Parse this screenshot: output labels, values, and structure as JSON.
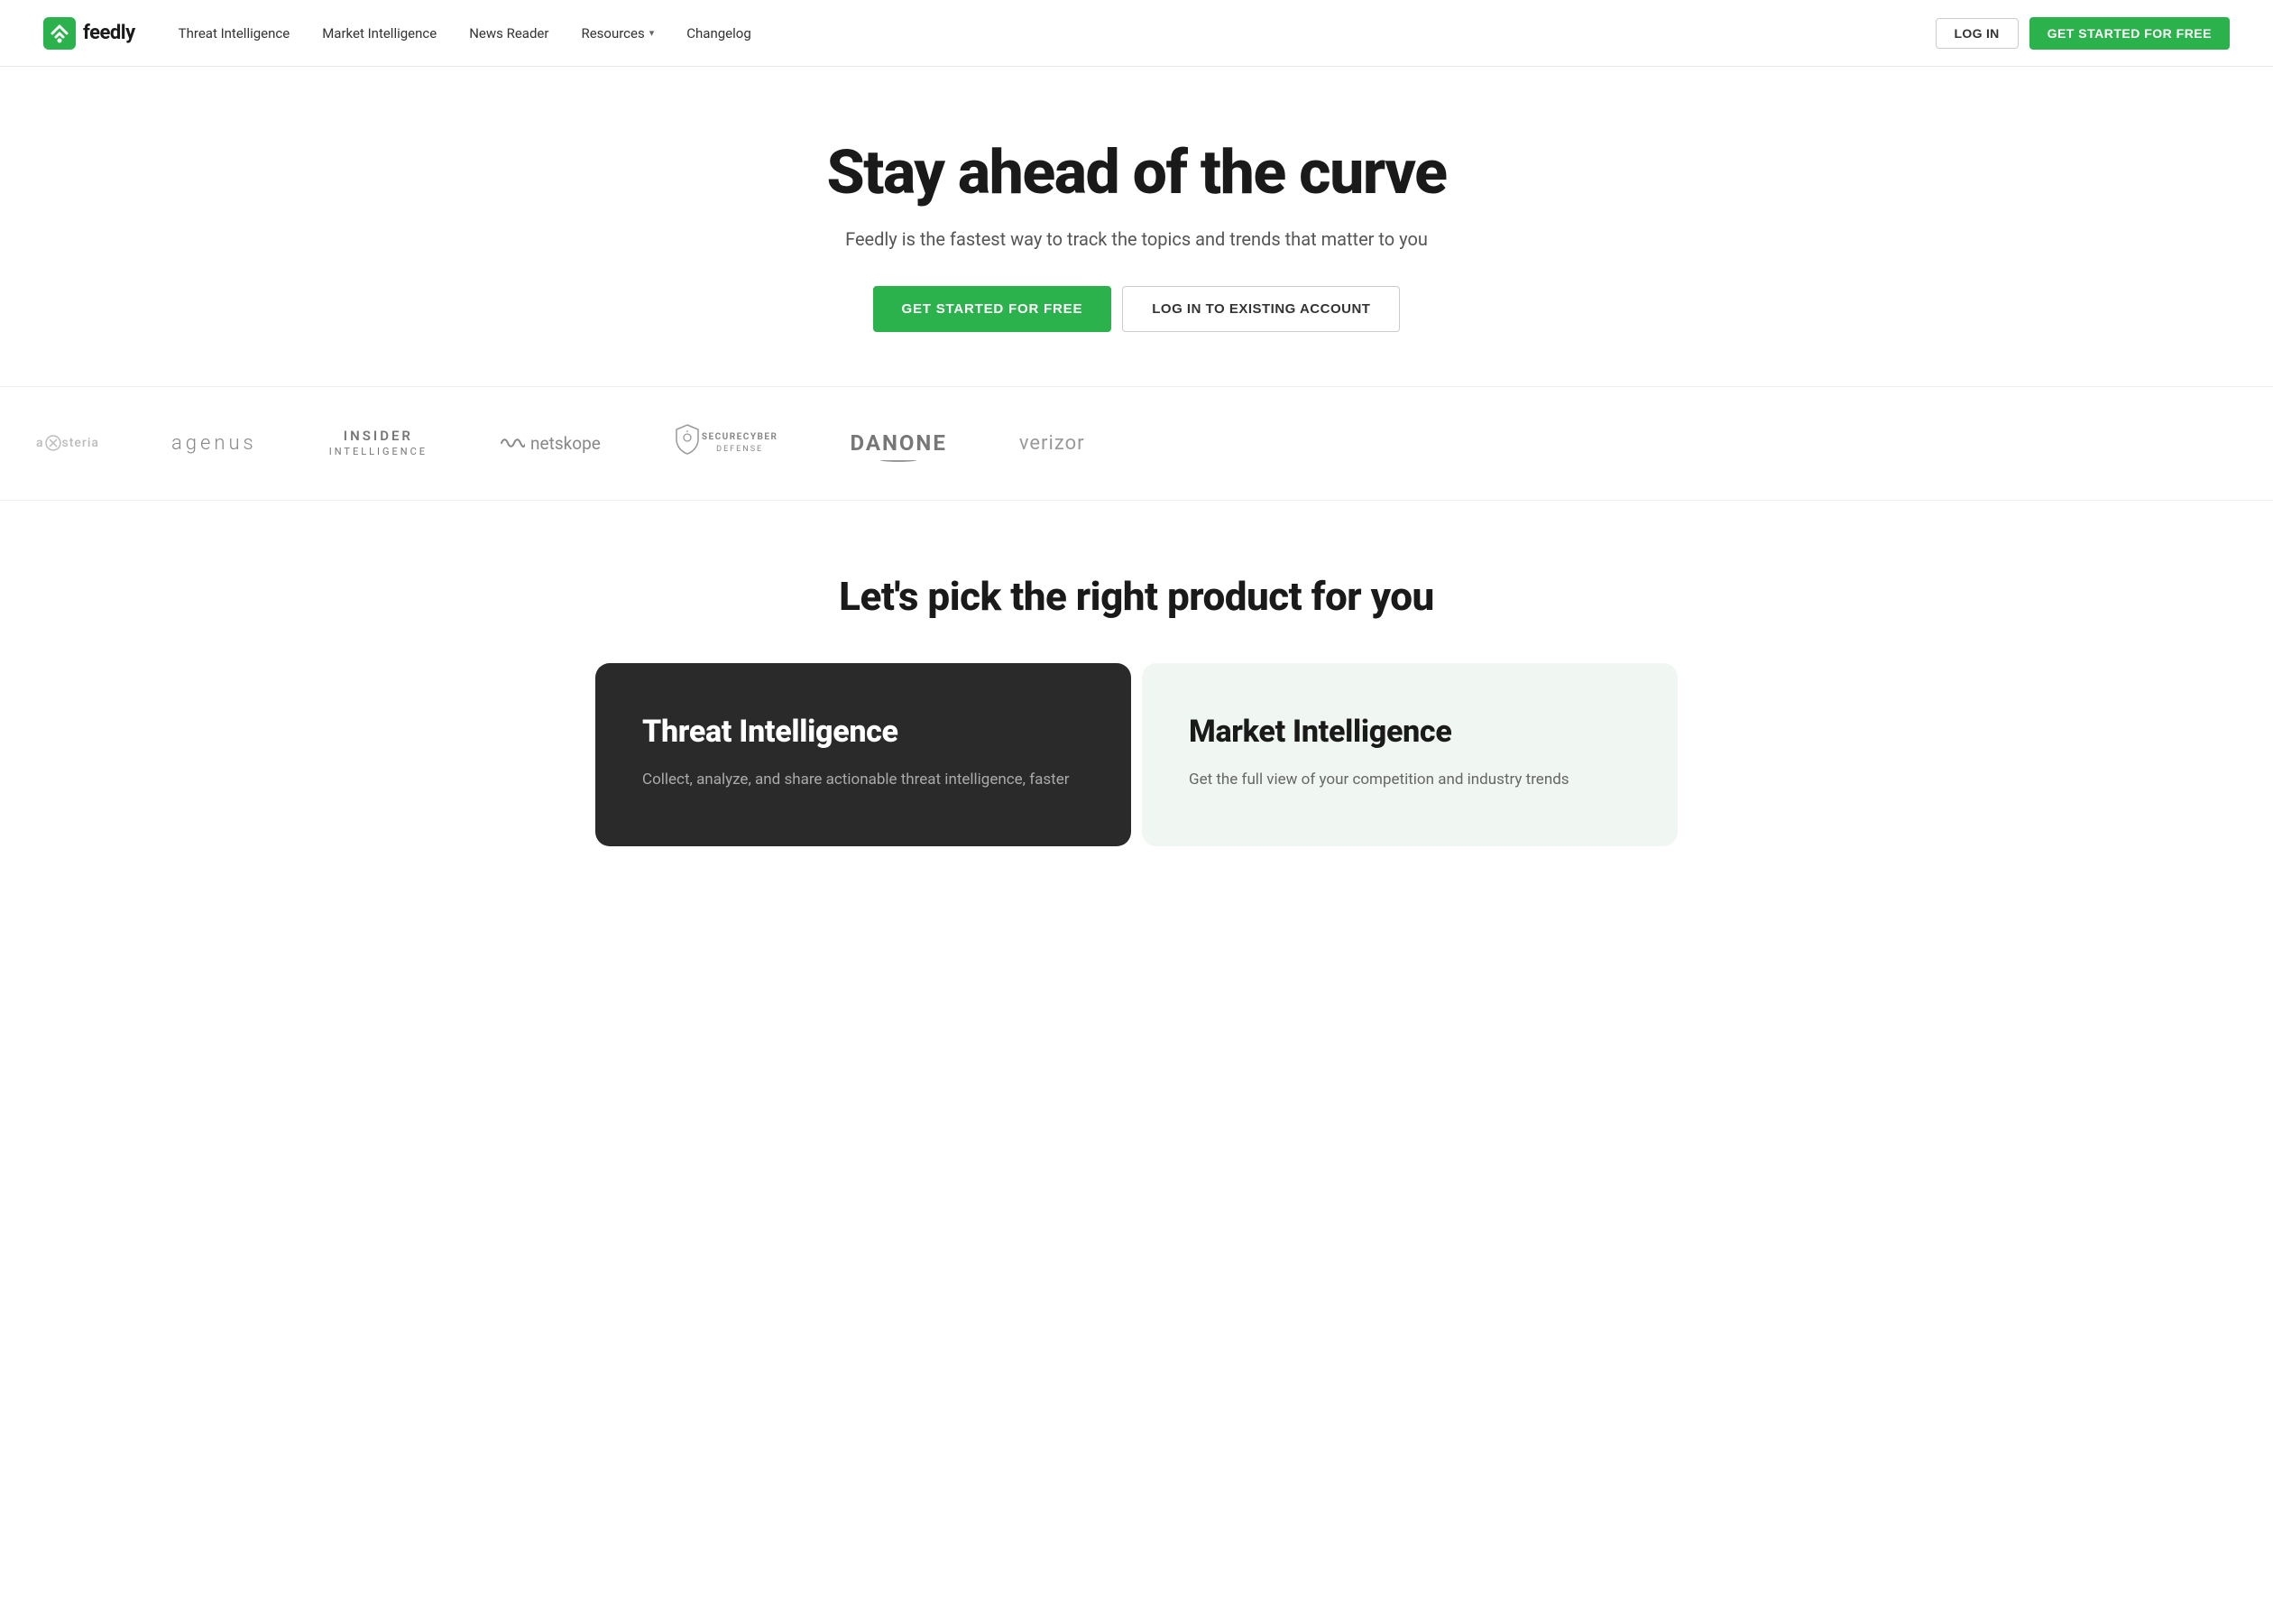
{
  "navbar": {
    "logo_text": "feedly",
    "nav_items": [
      {
        "label": "Threat Intelligence",
        "id": "threat-intelligence",
        "has_dropdown": false
      },
      {
        "label": "Market Intelligence",
        "id": "market-intelligence",
        "has_dropdown": false
      },
      {
        "label": "News Reader",
        "id": "news-reader",
        "has_dropdown": false
      },
      {
        "label": "Resources",
        "id": "resources",
        "has_dropdown": true
      },
      {
        "label": "Changelog",
        "id": "changelog",
        "has_dropdown": false
      }
    ],
    "login_label": "LOG IN",
    "get_started_label": "GET STARTED FOR FREE"
  },
  "hero": {
    "title": "Stay ahead of the curve",
    "subtitle": "Feedly is the fastest way to track the topics and trends that matter to you",
    "cta_primary": "GET STARTED FOR FREE",
    "cta_secondary": "LOG IN TO EXISTING ACCOUNT"
  },
  "logos": {
    "items": [
      {
        "id": "steria",
        "display": "a⊗steria",
        "style": "steria"
      },
      {
        "id": "agenus",
        "display": "agenus",
        "style": "agenus"
      },
      {
        "id": "insider",
        "line1": "INSIDER",
        "line2": "INTELLIGENCE",
        "style": "insider"
      },
      {
        "id": "netskope",
        "display": "netskope",
        "style": "netskope"
      },
      {
        "id": "securecyber",
        "display": "SECURECYBER",
        "sub": "DEFENSE",
        "style": "securecyber"
      },
      {
        "id": "danone",
        "display": "DANONE",
        "style": "danone"
      },
      {
        "id": "verizon",
        "display": "verizor",
        "style": "verizon"
      }
    ]
  },
  "products": {
    "section_title": "Let's pick the right product for you",
    "cards": [
      {
        "id": "threat-intelligence",
        "title": "Threat Intelligence",
        "description": "Collect, analyze, and share actionable threat intelligence, faster",
        "theme": "dark"
      },
      {
        "id": "market-intelligence",
        "title": "Market Intelligence",
        "description": "Get the full view of your competition and industry trends",
        "theme": "light"
      }
    ]
  }
}
